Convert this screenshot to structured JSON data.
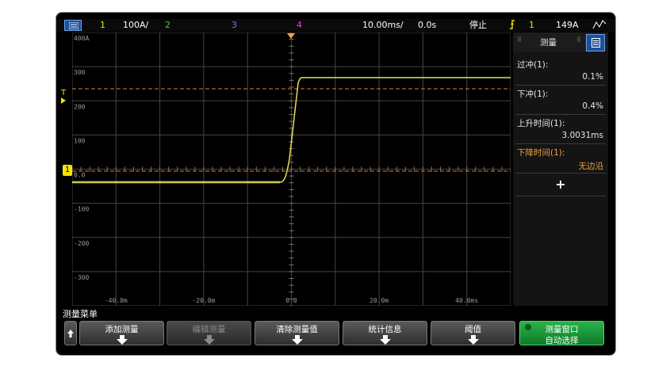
{
  "top_bar": {
    "ch1_num": "1",
    "ch1_scale": "100A/",
    "ch2_num": "2",
    "ch3_num": "3",
    "ch4_num": "4",
    "timebase": "10.00ms/",
    "delay": "0.0s",
    "run_state": "停止",
    "trigger_source": "1",
    "trigger_level": "149A",
    "colors": {
      "ch1": "#f5e400",
      "ch2": "#3cd03c",
      "ch3": "#6a7cff",
      "ch4": "#ff3cc8",
      "text": "#ffffff"
    }
  },
  "plot": {
    "y_labels": [
      "400A",
      "300",
      "200",
      "100",
      "0.0",
      "-100",
      "-200",
      "-300"
    ],
    "x_labels": [
      "-40.0m",
      "-20.0m",
      "0.0",
      "20.0m",
      "40.0ms"
    ],
    "ch1_marker": "1",
    "trigger_marker": "T",
    "colors": {
      "trace": "#e8e05a",
      "cursor": "#d4823a",
      "grid": "#444444"
    }
  },
  "panel": {
    "title": "测量",
    "items": [
      {
        "label": "过冲(1):",
        "value": "0.1%"
      },
      {
        "label": "下冲(1):",
        "value": "0.4%"
      },
      {
        "label": "上升时间(1):",
        "value": "3.0031ms"
      },
      {
        "label": "下降时间(1):",
        "value": "无边沿"
      }
    ],
    "add_label": "+",
    "highlight_color": "#f2a13c"
  },
  "softkeys": {
    "menu_title": "测量菜单",
    "buttons": [
      {
        "label": "添加测量",
        "sub": ""
      },
      {
        "label": "编辑测量",
        "sub": ""
      },
      {
        "label": "清除测量值",
        "sub": ""
      },
      {
        "label": "统计信息",
        "sub": ""
      },
      {
        "label": "阈值",
        "sub": ""
      },
      {
        "label": "测量窗口",
        "sub": "自动选择"
      }
    ]
  }
}
